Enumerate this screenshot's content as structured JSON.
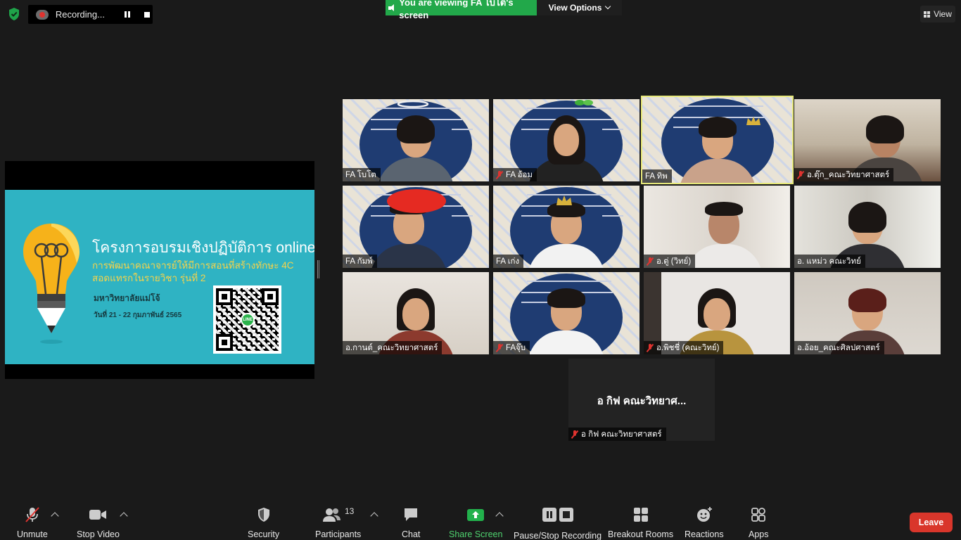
{
  "top_bar": {
    "recording_text": "Recording...",
    "viewing_banner": "You are viewing FA โบโต's screen",
    "view_options_label": "View Options",
    "view_label": "View"
  },
  "shared_slide": {
    "title": "โครงการอบรมเชิงปฏิบัติการ online",
    "subtitle_line1": "การพัฒนาคณาจารย์ให้มีการสอนที่สร้างทักษะ 4C",
    "subtitle_line2": "สอดแทรกในรายวิชา รุ่นที่ 2",
    "university": "มหาวิทยาลัยแม่โจ้",
    "date": "วันที่ 21 - 22 กุมภาพันธ์ 2565",
    "qr_badge": "LINE"
  },
  "participants": [
    {
      "name": "FA โบโต",
      "muted": false
    },
    {
      "name": "FA อ้อม",
      "muted": true
    },
    {
      "name": "FA ทิพ",
      "muted": false
    },
    {
      "name": "อ.ตุ๊ก_คณะวิทยาศาสตร์",
      "muted": true
    },
    {
      "name": "FA กัมพ์",
      "muted": false
    },
    {
      "name": "FA เก่ง",
      "muted": false
    },
    {
      "name": "อ.ตู่ (วิทย์)",
      "muted": true
    },
    {
      "name": "อ. แหม่ว คณะวิทย์",
      "muted": false
    },
    {
      "name": "อ.กานต์_คณะวิทยาศาสตร์",
      "muted": false
    },
    {
      "name": "FAจุ๊บ",
      "muted": true
    },
    {
      "name": "อ.พิชชี่ (คณะวิทย์)",
      "muted": true
    },
    {
      "name": "อ.อ้อย_คณะศิลปศาสตร์",
      "muted": false
    },
    {
      "name": "อ กิฟ คณะวิทยาศาสตร์",
      "muted": true
    }
  ],
  "name_only_display": "อ กิฟ คณะวิทยาศ...",
  "toolbar": {
    "unmute": "Unmute",
    "stop_video": "Stop Video",
    "security": "Security",
    "participants": "Participants",
    "participants_count": "13",
    "chat": "Chat",
    "share_screen": "Share Screen",
    "pause_stop_recording": "Pause/Stop Recording",
    "breakout_rooms": "Breakout Rooms",
    "reactions": "Reactions",
    "apps": "Apps",
    "leave": "Leave"
  },
  "colors": {
    "share_green": "#22a84a",
    "leave_red": "#d9362b",
    "active_speaker": "#e6e87a",
    "slide_teal": "#2fb3c3",
    "slide_yellow": "#f6d34a"
  },
  "icons": [
    "shield-icon",
    "record-icon",
    "pause-icon",
    "stop-icon",
    "speaker-icon",
    "chevron-down-icon",
    "grid-view-icon",
    "mic-muted-icon",
    "video-camera-icon",
    "security-shield-icon",
    "participants-icon",
    "chat-bubble-icon",
    "share-screen-icon",
    "pause-stop-recording-icon",
    "breakout-rooms-icon",
    "reactions-icon",
    "apps-icon"
  ]
}
